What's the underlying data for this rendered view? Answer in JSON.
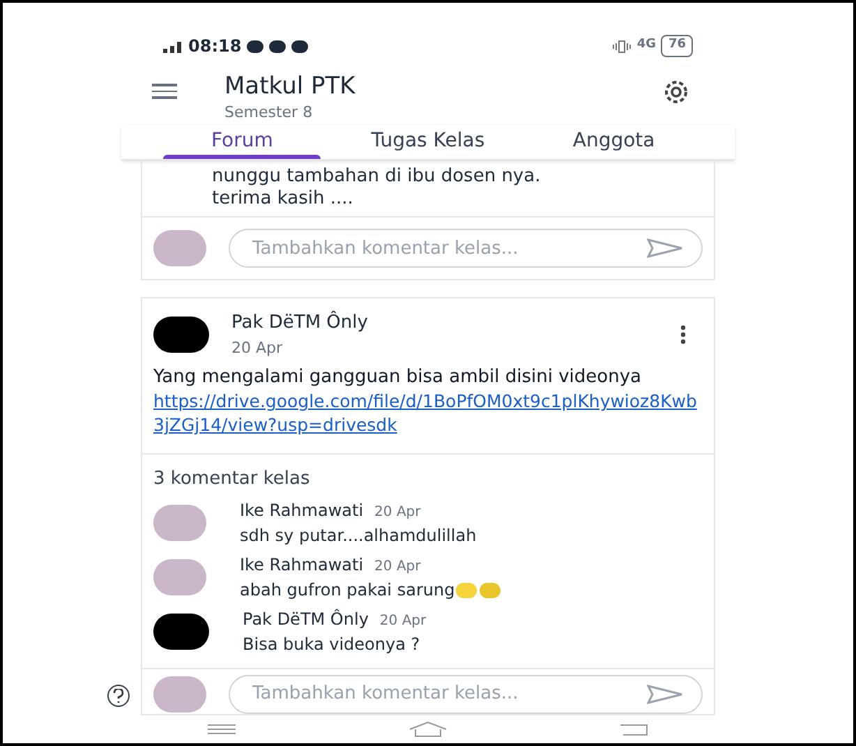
{
  "status_bar": {
    "time": "08:18",
    "network": "4G",
    "battery": "76"
  },
  "header": {
    "title": "Matkul PTK",
    "subtitle": "Semester 8"
  },
  "tabs": [
    {
      "label": "Forum",
      "selected": true
    },
    {
      "label": "Tugas Kelas",
      "selected": false
    },
    {
      "label": "Anggota",
      "selected": false
    }
  ],
  "previous_post": {
    "text_lines": [
      "nunggu tambahan di ibu dosen nya.",
      "terima kasih ...."
    ],
    "comment_placeholder": "Tambahkan komentar kelas..."
  },
  "post": {
    "author": "Pak DëTM Ônly",
    "date": "20 Apr",
    "text": "Yang mengalami gangguan bisa ambil disini videonya",
    "link": "https://drive.google.com/file/d/1BoPfOM0xt9c1plKhywioz8Kwb3jZGj14/view?usp=drivesdk",
    "comment_count": "3 komentar kelas",
    "comments": [
      {
        "author": "Ike Rahmawati",
        "date": "20 Apr",
        "text": "sdh sy putar....alhamdulillah",
        "kind": "photo"
      },
      {
        "author": "Ike Rahmawati",
        "date": "20 Apr",
        "text": "abah gufron pakai sarung",
        "kind": "photo",
        "emojis": [
          {
            "kind": "smile"
          },
          {
            "kind": "grin"
          }
        ]
      },
      {
        "author": "Pak DëTM Ônly",
        "date": "20 Apr",
        "text": "Bisa buka videonya ?",
        "kind": "dark"
      }
    ],
    "comment_placeholder": "Tambahkan komentar kelas..."
  }
}
